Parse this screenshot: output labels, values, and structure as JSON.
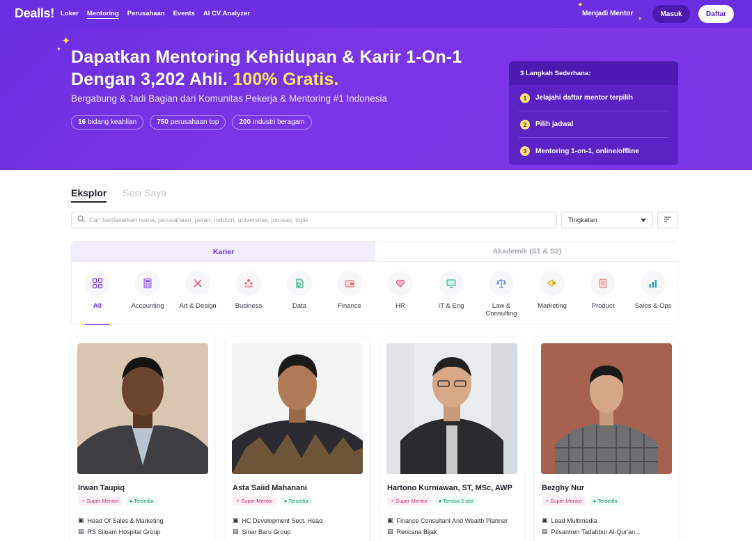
{
  "nav": {
    "logo": "Dealls!",
    "links": [
      "Loker",
      "Mentoring",
      "Perusahaan",
      "Events",
      "AI CV Analyzer"
    ],
    "active": "Mentoring",
    "mentor_cta": "Menjadi Mentor",
    "login": "Masuk",
    "register": "Daftar"
  },
  "hero": {
    "title_line1": "Dapatkan Mentoring Kehidupan & Karir 1-On-1",
    "title_line2_a": "Dengan 3,202 Ahli. ",
    "title_line2_b": "100% Gratis.",
    "subtitle": "Bergabung & Jadi Bagian dari Komunitas Pekerja & Mentoring #1 Indonesia",
    "chips": [
      {
        "num": "16",
        "text": "bidang keahlian"
      },
      {
        "num": "750",
        "text": "perusahaan top"
      },
      {
        "num": "200",
        "text": "industri beragam"
      }
    ]
  },
  "steps": {
    "title": "3 Langkah Sederhana:",
    "items": [
      {
        "n": "1",
        "text": "Jelajahi daftar mentor terpilih"
      },
      {
        "n": "2",
        "text": "Pilih jadwal"
      },
      {
        "n": "3",
        "text": "Mentoring 1-on-1, online/offline"
      }
    ]
  },
  "tabs": {
    "explore": "Eksplor",
    "sessions": "Sesi Saya"
  },
  "search": {
    "placeholder": "Cari berdasarkan nama, perusahaan, peran, industri, universitas, jurusan, topik",
    "level_select": "Tingkatan"
  },
  "segments": {
    "career": "Karier",
    "academic": "Akademik (S1 & S2)"
  },
  "categories": [
    {
      "label": "All",
      "icon": "grid-icon"
    },
    {
      "label": "Accounting",
      "icon": "calculator-icon"
    },
    {
      "label": "Art & Design",
      "icon": "design-tools-icon"
    },
    {
      "label": "Business",
      "icon": "people-icon"
    },
    {
      "label": "Data",
      "icon": "data-icon"
    },
    {
      "label": "Finance",
      "icon": "wallet-icon"
    },
    {
      "label": "HR",
      "icon": "heart-hand-icon"
    },
    {
      "label": "IT & Eng",
      "icon": "monitor-icon"
    },
    {
      "label": "Law & Consulting",
      "icon": "scale-icon"
    },
    {
      "label": "Marketing",
      "icon": "megaphone-icon"
    },
    {
      "label": "Product",
      "icon": "product-icon"
    },
    {
      "label": "Sales & Ops",
      "icon": "bar-chart-icon"
    }
  ],
  "mentors": [
    {
      "name": "Irwan Taupiq",
      "badge": "Super Mentor",
      "availability": "Tersedia",
      "role": "Head Of Sales & Marketing",
      "company": "RS Siloam Hospital Group"
    },
    {
      "name": "Asta Saiid Mahanani",
      "badge": "Super Mentor",
      "availability": "Tersedia",
      "role": "HC Development Sect. Head",
      "company": "Sinar Baru Group"
    },
    {
      "name": "Hartono Kurniawan, ST, MSc, AWP",
      "badge": "Super Mentor",
      "availability": "Tersisa 2 slot",
      "role": "Finance Consultant And Wealth Planner",
      "company": "Rencana Bijak"
    },
    {
      "name": "Bezghy Nur",
      "badge": "Super Mentor",
      "availability": "Tersedia",
      "role": "Lead Multimedia",
      "company": "Pesantren Tadabbur Al-Qur'an..."
    }
  ],
  "colors": {
    "brand": "#6a2fe0",
    "highlight": "#ffe45c",
    "super_mentor": "#d0317e",
    "available": "#169a6a"
  }
}
